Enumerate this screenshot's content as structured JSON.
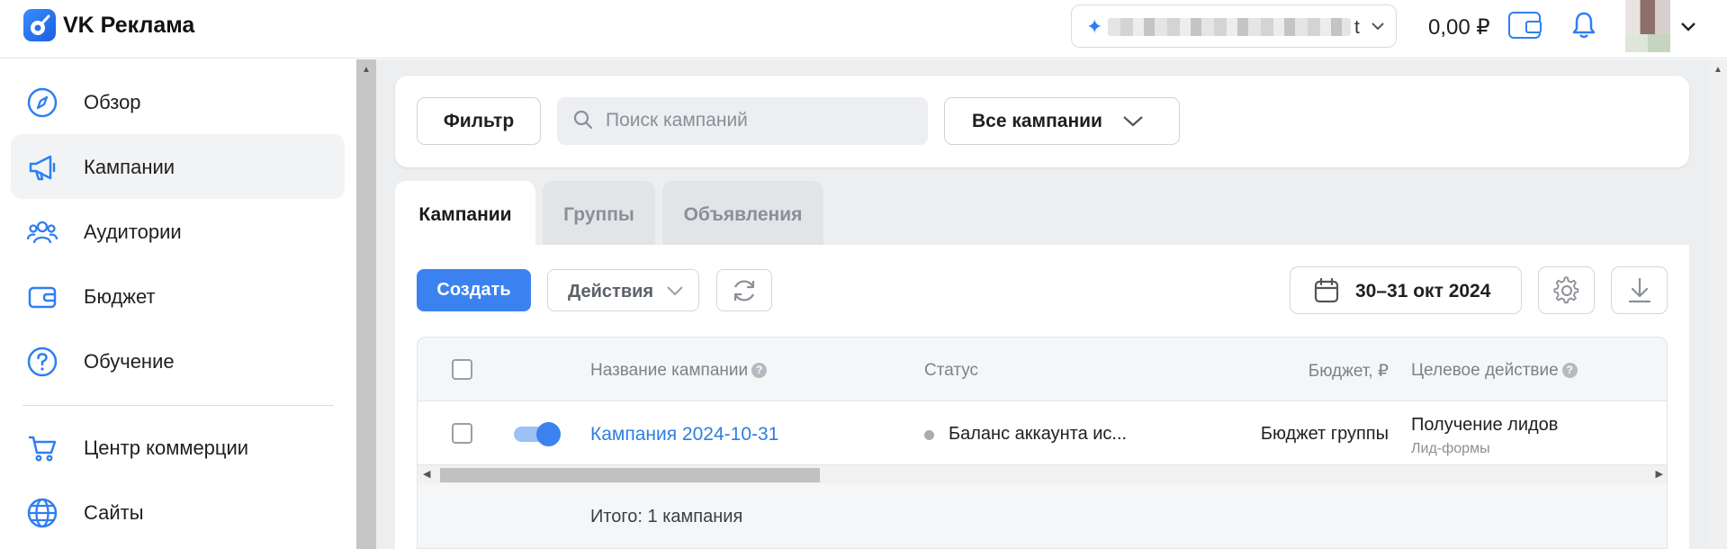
{
  "header": {
    "app_title": "VK Реклама",
    "account_suffix": "t",
    "balance": "0,00 ₽"
  },
  "sidebar": {
    "items": [
      {
        "label": "Обзор",
        "icon": "compass-icon"
      },
      {
        "label": "Кампании",
        "icon": "megaphone-icon",
        "active": true
      },
      {
        "label": "Аудитории",
        "icon": "users-icon"
      },
      {
        "label": "Бюджет",
        "icon": "wallet-icon"
      },
      {
        "label": "Обучение",
        "icon": "help-circle-icon"
      },
      {
        "label": "Центр коммерции",
        "icon": "cart-icon"
      },
      {
        "label": "Сайты",
        "icon": "globe-icon"
      }
    ]
  },
  "filters": {
    "filter_label": "Фильтр",
    "search_placeholder": "Поиск кампаний",
    "scope_label": "Все кампании"
  },
  "tabs": [
    {
      "label": "Кампании",
      "active": true
    },
    {
      "label": "Группы",
      "active": false
    },
    {
      "label": "Объявления",
      "active": false
    }
  ],
  "toolbar": {
    "create_label": "Создать",
    "actions_label": "Действия",
    "date_range": "30–31 окт 2024"
  },
  "table": {
    "columns": {
      "name": "Название кампании",
      "status": "Статус",
      "budget": "Бюджет, ₽",
      "goal": "Целевое действие"
    },
    "rows": [
      {
        "enabled": true,
        "name": "Кампания 2024-10-31",
        "status": "Баланс аккаунта ис...",
        "budget": "Бюджет группы",
        "goal": "Получение лидов",
        "goal_sub": "Лид-формы"
      }
    ],
    "total": "Итого: 1 кампания"
  },
  "colors": {
    "accent": "#3b82f0",
    "link": "#2e7fe0",
    "background": "#edeef0"
  }
}
